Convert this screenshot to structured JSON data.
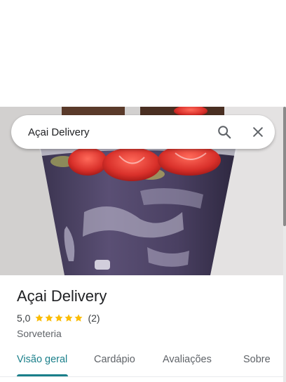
{
  "search": {
    "value": "Açai Delivery",
    "search_icon": "search-icon",
    "close_icon": "close-icon"
  },
  "place": {
    "title": "Açai Delivery",
    "rating": "5,0",
    "stars": 5,
    "review_count": "(2)",
    "category": "Sorveteria"
  },
  "tabs": [
    {
      "label": "Visão geral",
      "active": true
    },
    {
      "label": "Cardápio",
      "active": false
    },
    {
      "label": "Avaliações",
      "active": false
    },
    {
      "label": "Sobre",
      "active": false
    }
  ],
  "colors": {
    "accent": "#1a7f8a",
    "star": "#fbbc04",
    "title": "#202124",
    "muted": "#5f6368"
  }
}
